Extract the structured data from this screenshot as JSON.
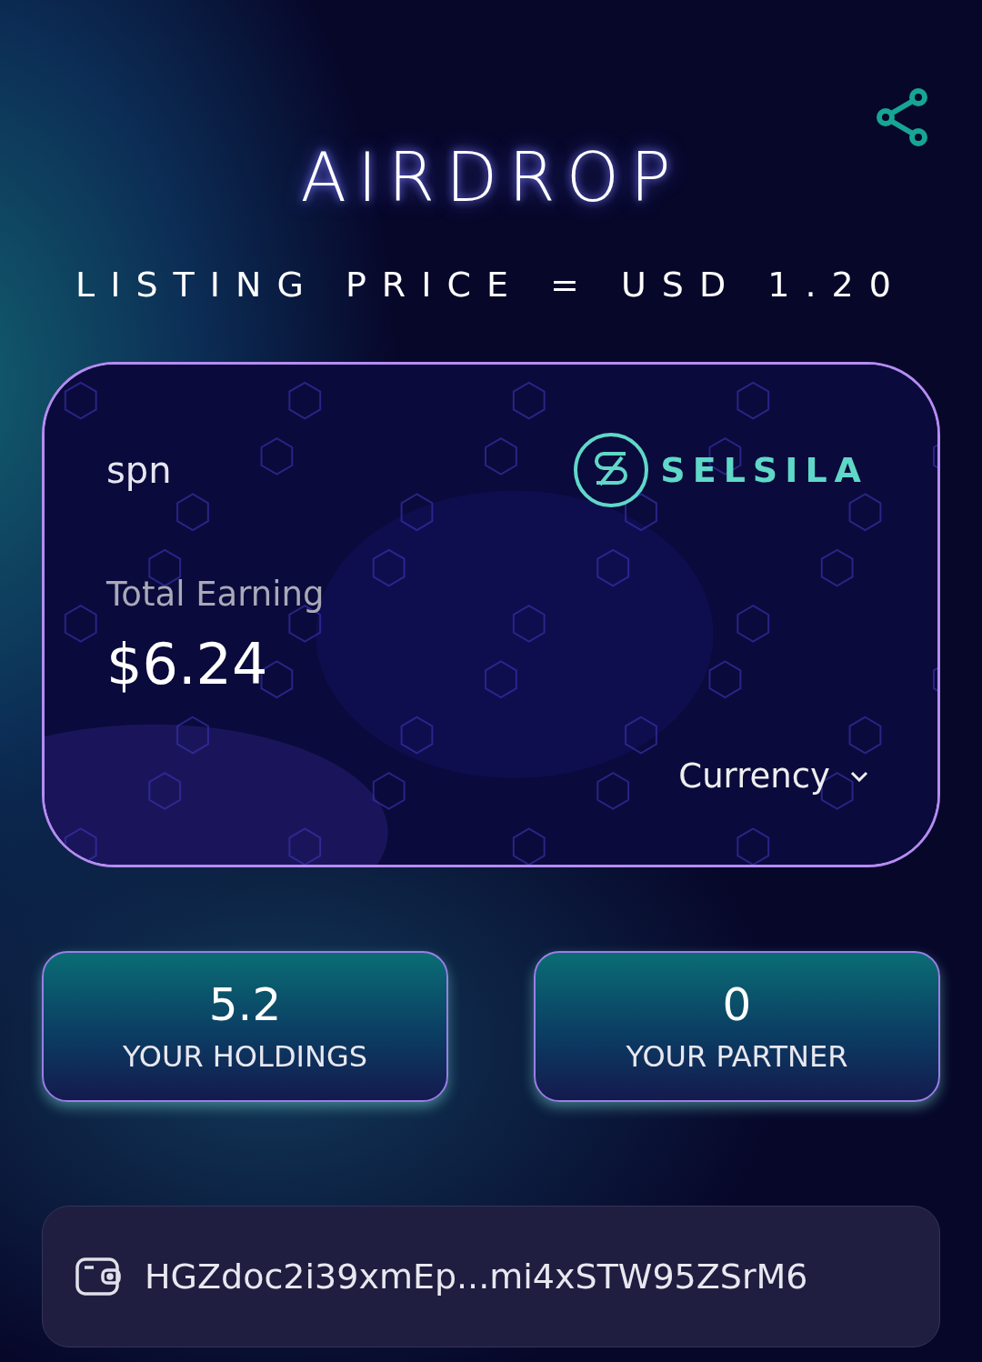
{
  "header": {
    "title": "AIRDROP",
    "listing_price": "LISTING PRICE = USD 1.20"
  },
  "earning_card": {
    "token": "spn",
    "brand": "SELSILA",
    "label": "Total Earning",
    "amount": "$6.24",
    "currency_selector": "Currency"
  },
  "stats": [
    {
      "value": "5.2",
      "label": "YOUR HOLDINGS"
    },
    {
      "value": "0",
      "label": "YOUR PARTNER"
    }
  ],
  "wallet": {
    "address": "HGZdoc2i39xmEp...mi4xSTW95ZSrM6"
  }
}
